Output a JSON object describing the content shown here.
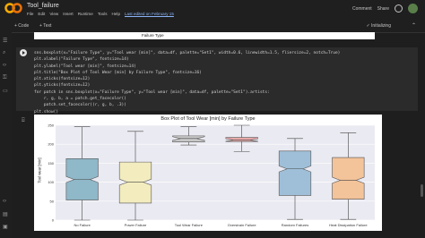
{
  "app": {
    "notebook_title": "Tool_failure",
    "menu": [
      "File",
      "Edit",
      "View",
      "Insert",
      "Runtime",
      "Tools",
      "Help"
    ],
    "last_edited": "Last edited on February 15",
    "comment_label": "Comment",
    "share_label": "Share"
  },
  "toolbar": {
    "code_label": "+ Code",
    "text_label": "+ Text",
    "status_label": "✓ Initializing"
  },
  "prev_output": {
    "label": "Failure Type"
  },
  "cell": {
    "code": "sns.boxplot(x=\"Failure Type\", y=\"Tool wear [min]\", data=df, palette=\"Set1\", width=0.6, linewidth=1.5, fliersize=2, notch=True)\nplt.xlabel(\"Failure Type\", fontsize=14)\nplt.ylabel(\"Tool wear [min]\", fontsize=14)\nplt.title(\"Box Plot of Tool Wear [min] by Failure Type\", fontsize=16)\nplt.xticks(fontsize=12)\nplt.yticks(fontsize=12)\nfor patch in sns.boxplot(x=\"Failure Type\", y=\"Tool wear [min]\", data=df, palette=\"Set1\").artists:\n    r, g, b, a = patch.get_facecolor()\n    patch.set_facecolor((r, g, b, .3))\nplt.show()"
  },
  "chart_data": {
    "type": "box",
    "title": "Box Plot of Tool Wear [min] by Failure Type",
    "xlabel": "",
    "ylabel": "Tool wear [min]",
    "ylim": [
      0,
      250
    ],
    "yticks": [
      0,
      50,
      100,
      150,
      200,
      250
    ],
    "categories": [
      "No Failure",
      "Power Failure",
      "Tool Wear Failure",
      "Overstrain Failure",
      "Random Failures",
      "Heat Dissipation Failure"
    ],
    "boxes": [
      {
        "min": 0,
        "q1": 53,
        "median": 107,
        "q3": 162,
        "max": 246,
        "color": "#8fb8c8"
      },
      {
        "min": 0,
        "q1": 45,
        "median": 100,
        "q3": 153,
        "max": 234,
        "color": "#f2ecbf"
      },
      {
        "min": 198,
        "q1": 206,
        "median": 215,
        "q3": 222,
        "max": 246,
        "color": "#c8c8c8"
      },
      {
        "min": 181,
        "q1": 207,
        "median": 211,
        "q3": 218,
        "max": 250,
        "color": "#e8a8a8"
      },
      {
        "min": 2,
        "q1": 65,
        "median": 135,
        "q3": 182,
        "max": 215,
        "color": "#9fbfd8"
      },
      {
        "min": 2,
        "q1": 55,
        "median": 105,
        "q3": 165,
        "max": 230,
        "color": "#f3c39a"
      }
    ],
    "grid": true
  },
  "colors": {
    "accent": "#8ab4f8",
    "bg": "#1e1e1e",
    "cell": "#2b2b2b"
  }
}
